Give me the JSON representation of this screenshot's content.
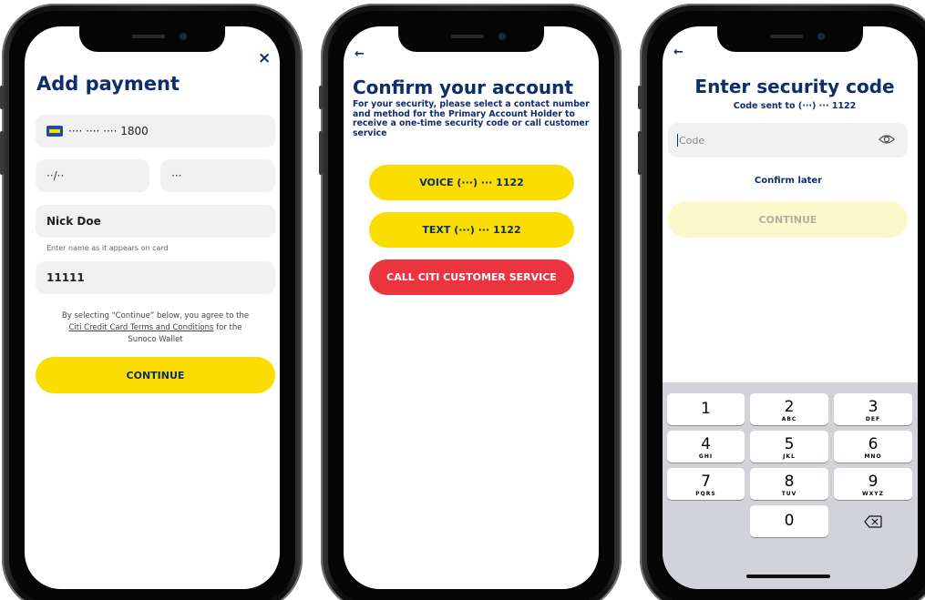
{
  "screen1": {
    "close_icon": "×",
    "title": "Add payment",
    "card_number": "···· ···· ···· 1800",
    "expiry_placeholder": "··/··",
    "cvv_placeholder": "···",
    "name_value": "Nick Doe",
    "name_hint": "Enter name as it appears on card",
    "zip_value": "11111",
    "terms_prefix": "By selecting “Continue” below, you agree to the",
    "terms_link": "Citi Credit Card Terms and Conditions",
    "terms_suffix": "for the",
    "terms_line3": "Sunoco Wallet",
    "continue_label": "CONTINUE"
  },
  "screen2": {
    "back_icon": "←",
    "title": "Confirm your account",
    "description": "For your security, please select a contact number and method for the Primary Account Holder to receive a one-time security code or call customer service",
    "voice_label": "VOICE (···) ··· 1122",
    "text_label": "TEXT (···) ··· 1122",
    "call_label": "CALL CITI CUSTOMER SERVICE"
  },
  "screen3": {
    "back_icon": "←",
    "title": "Enter security code",
    "subtitle": "Code sent to (···) ··· 1122",
    "code_placeholder": "Code",
    "confirm_later": "Confirm later",
    "continue_label": "CONTINUE",
    "keypad": {
      "k1": {
        "num": "1",
        "letters": ""
      },
      "k2": {
        "num": "2",
        "letters": "ABC"
      },
      "k3": {
        "num": "3",
        "letters": "DEF"
      },
      "k4": {
        "num": "4",
        "letters": "GHI"
      },
      "k5": {
        "num": "5",
        "letters": "JKL"
      },
      "k6": {
        "num": "6",
        "letters": "MNO"
      },
      "k7": {
        "num": "7",
        "letters": "PQRS"
      },
      "k8": {
        "num": "8",
        "letters": "TUV"
      },
      "k9": {
        "num": "9",
        "letters": "WXYZ"
      },
      "k0": {
        "num": "0",
        "letters": ""
      }
    }
  },
  "colors": {
    "navy": "#0d2d6c",
    "yellow": "#fcdd00",
    "red": "#ec3340",
    "pale_yellow": "#fdf7cc",
    "field_gray": "#f1f1f1",
    "keypad_gray": "#d2d3d8"
  },
  "icons": [
    "close-icon",
    "back-arrow-icon",
    "card-brand-icon",
    "eye-icon",
    "backspace-icon"
  ]
}
